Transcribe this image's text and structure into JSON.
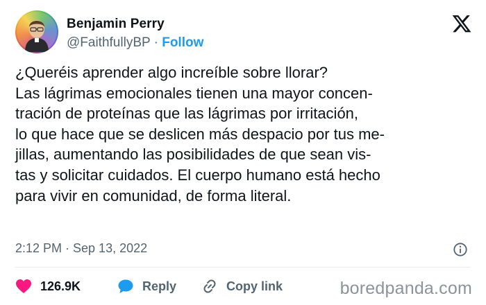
{
  "author": {
    "name": "Benjamin Perry",
    "handle": "@FaithfullyBP",
    "separator": "·",
    "follow_label": "Follow"
  },
  "tweet_lines": [
    "¿Queréis aprender algo increíble sobre llorar?",
    "Las lágrimas emocionales tienen una mayor concen-",
    "tración de proteínas que las lágrimas por irritación,",
    "lo que hace que se deslicen más despacio por tus me-",
    "jillas, aumentando las posibilidades de que sean vis-",
    "tas y solicitar cuidados. El cuerpo humano está hecho",
    "para vivir en comunidad, de forma literal."
  ],
  "timestamp": "2:12 PM · Sep 13, 2022",
  "actions": {
    "likes": "126.9K",
    "reply_label": "Reply",
    "copy_link_label": "Copy link"
  },
  "watermark": "boredpanda.com",
  "colors": {
    "accent": "#1d9bf0",
    "like": "#f91880",
    "text": "#0f1419",
    "muted": "#536471"
  },
  "icons": [
    "x-logo-icon",
    "info-icon",
    "heart-icon",
    "reply-bubble-icon",
    "link-icon"
  ]
}
